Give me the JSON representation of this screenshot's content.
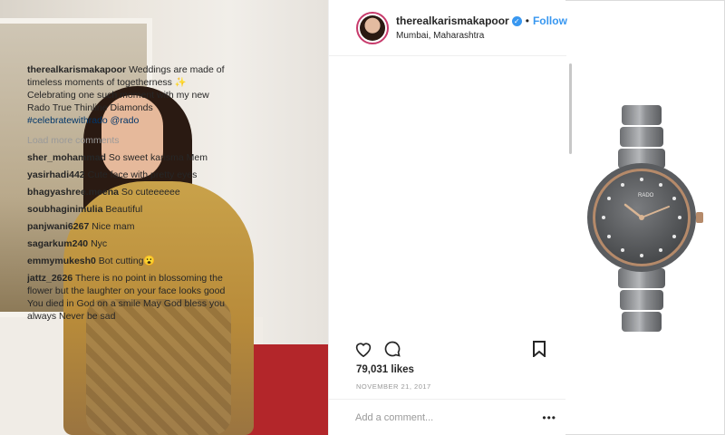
{
  "post": {
    "username": "therealkarismakapoor",
    "verified_icon": "verified-check-icon",
    "separator": "•",
    "follow_label": "Follow",
    "location": "Mumbai, Maharashtra"
  },
  "caption": {
    "user": "therealkarismakapoor",
    "text": "Weddings are made of timeless moments of togetherness ✨ Celebrating one such moment with my new Rado True Thinline Diamonds",
    "hashtag": "#celebratewithrado",
    "mention": "@rado"
  },
  "load_more_label": "Load more comments",
  "comments": [
    {
      "user": "sher_mohammad",
      "text": "So sweet karisma Mem"
    },
    {
      "user": "yasirhadi442",
      "text": "Cute face with pretty eyes"
    },
    {
      "user": "bhagyashree.meena",
      "text": "So cuteeeeee"
    },
    {
      "user": "soubhaginimulia",
      "text": "Beautiful"
    },
    {
      "user": "panjwani6267",
      "text": "Nice mam"
    },
    {
      "user": "sagarkum240",
      "text": "Nyc"
    },
    {
      "user": "emmymukesh0",
      "text": "Bot cutting😮"
    },
    {
      "user": "jattz_2626",
      "text": "There is no point in blossoming the flower but the laughter on your face looks good You died in God on a smile May God bless you always Never be sad"
    }
  ],
  "likes": "79,031 likes",
  "date": "November 21, 2017",
  "add_comment_placeholder": "Add a comment...",
  "more_label": "•••",
  "watch_brand": "RADO",
  "colors": {
    "link": "#3897f0",
    "hashtag": "#003569",
    "muted": "#999999",
    "text": "#262626"
  }
}
